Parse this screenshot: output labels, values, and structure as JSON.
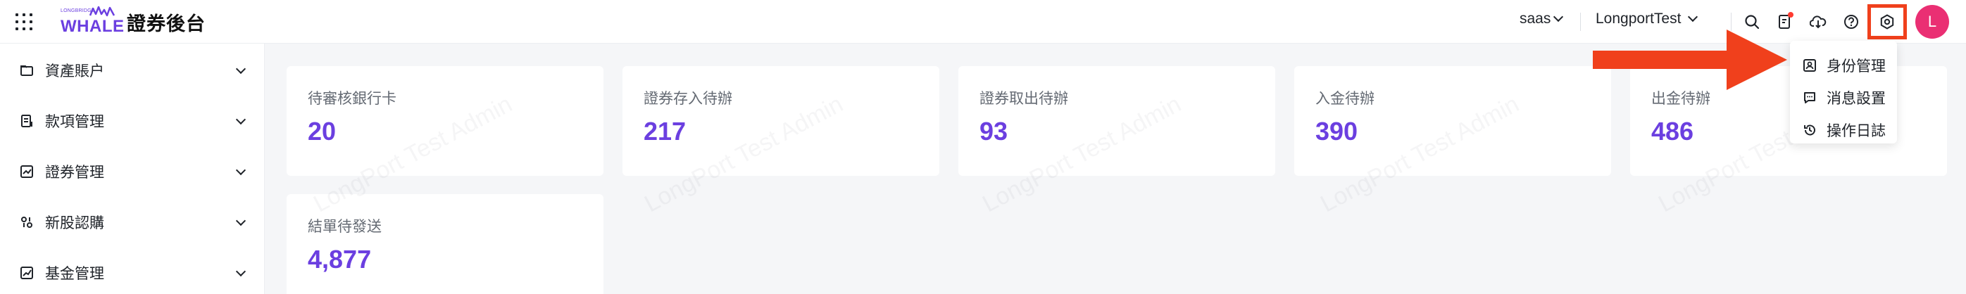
{
  "header": {
    "logo_small": "LONGBRIDGE",
    "logo_big": "WHALE",
    "app_title": "證券後台",
    "env_select": "saas",
    "org_select": "LongportTest",
    "icons": [
      "search-icon",
      "document-alert-icon",
      "download-icon",
      "help-icon",
      "settings-icon"
    ],
    "avatar_letter": "L"
  },
  "sidebar": {
    "items": [
      {
        "label": "資產賬户",
        "icon": "folder-icon"
      },
      {
        "label": "款項管理",
        "icon": "ledger-icon"
      },
      {
        "label": "證券管理",
        "icon": "chart-icon"
      },
      {
        "label": "新股認購",
        "icon": "ipo-icon"
      },
      {
        "label": "基金管理",
        "icon": "fund-chart-icon"
      }
    ]
  },
  "cards": [
    {
      "label": "待審核銀行卡",
      "value": "20"
    },
    {
      "label": "證券存入待辦",
      "value": "217"
    },
    {
      "label": "證券取出待辦",
      "value": "93"
    },
    {
      "label": "入金待辦",
      "value": "390"
    },
    {
      "label": "出金待辦",
      "value": "486"
    },
    {
      "label": "結單待發送",
      "value": "4,877"
    }
  ],
  "watermark_text": "LongPort Test Admin",
  "settings_menu": {
    "items": [
      {
        "label": "身份管理",
        "icon": "id-card-icon"
      },
      {
        "label": "消息設置",
        "icon": "message-icon"
      },
      {
        "label": "操作日誌",
        "icon": "history-icon"
      }
    ]
  },
  "colors": {
    "accent": "#6b3fe0",
    "avatar": "#ea2f73",
    "highlight": "#f0401c"
  }
}
